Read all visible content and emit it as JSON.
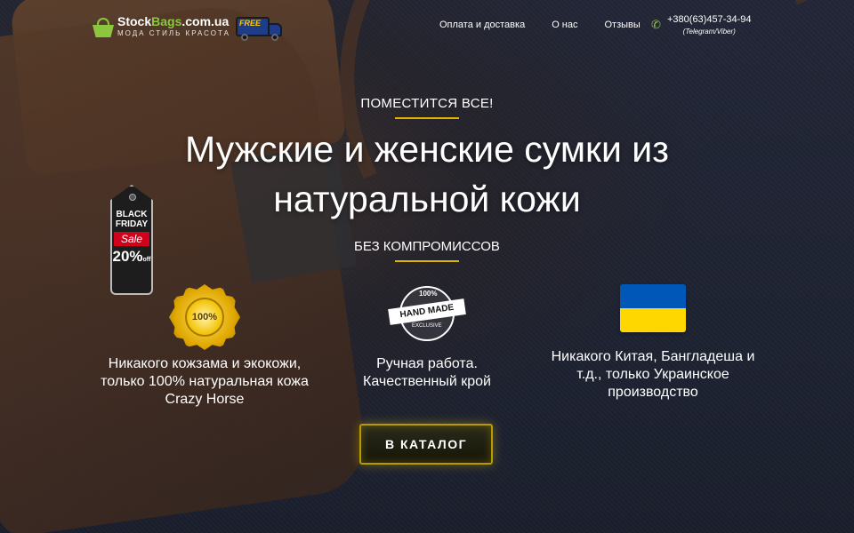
{
  "header": {
    "logo": {
      "name_white": "Stock",
      "name_green": "Bags",
      "domain": ".com.ua",
      "tagline": "МОДА  СТИЛЬ  КРАСОТА",
      "badge": "FREE"
    },
    "nav": [
      {
        "label": "Оплата и доставка"
      },
      {
        "label": "О нас"
      },
      {
        "label": "Отзывы"
      }
    ],
    "phone": {
      "number": "+380(63)457-34-94",
      "note": "(Telegram/Viber)"
    }
  },
  "hero": {
    "kicker": "ПОМЕСТИТСЯ ВСЕ!",
    "title_line1": "Мужские и женские сумки из",
    "title_line2": "натуральной кожи",
    "subtitle": "БЕЗ КОМПРОМИССОВ"
  },
  "promo": {
    "line1": "BLACK",
    "line2": "FRIDAY",
    "sale": "Sale",
    "percent": "20%",
    "off": "off"
  },
  "features": [
    {
      "icon": "genuine-leather-seal-icon",
      "badge": "100%",
      "line1": "Никакого кожзама и экокожи,",
      "line2": "только 100% натуральная кожа",
      "line3": "Crazy Horse"
    },
    {
      "icon": "hand-made-stamp-icon",
      "badge": "HAND MADE",
      "badge_top": "100%",
      "badge_bottom": "EXCLUSIVE",
      "line1": "Ручная работа.",
      "line2": "Качественный крой"
    },
    {
      "icon": "ukraine-flag-icon",
      "line1": "Никакого Китая, Бангладеша и",
      "line2": "т.д., только Украинское",
      "line3": "производство"
    }
  ],
  "cta": {
    "label": "В КАТАЛОГ"
  },
  "colors": {
    "accent_gold": "#e0b400",
    "brand_green": "#8cc63f",
    "flag_blue": "#0057b7",
    "flag_yellow": "#ffd700"
  }
}
